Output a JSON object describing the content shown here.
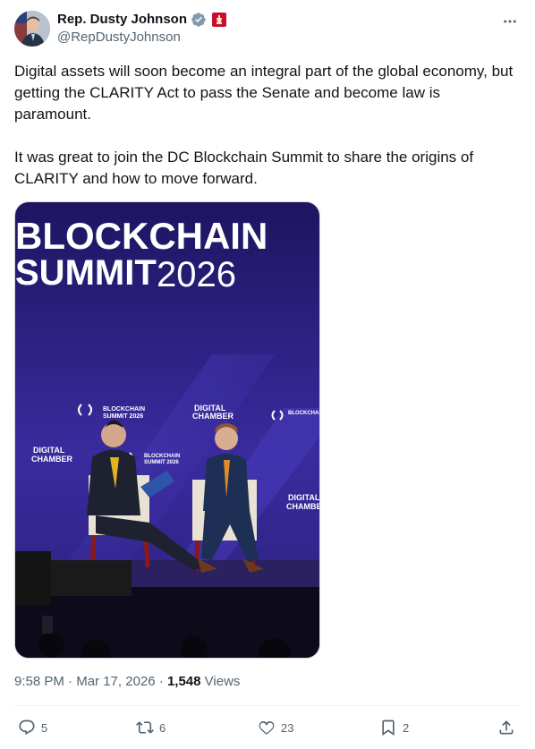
{
  "author": {
    "display_name": "Rep. Dusty Johnson",
    "handle": "@RepDustyJohnson"
  },
  "tweet": {
    "text": "Digital assets will soon become an integral part of the global economy, but getting the CLARITY Act to pass the Senate and become law is paramount.\n\nIt was great to join the DC Blockchain Summit to share the origins of CLARITY and how to move forward."
  },
  "media": {
    "banner_line1": "BLOCKCHAIN",
    "banner_line2": "SUMMIT",
    "banner_year": "2026",
    "backdrop_logo_line1": "BLOCKCHAIN",
    "backdrop_logo_line2": "SUMMIT 2026",
    "backdrop_chamber_line1": "DIGITAL",
    "backdrop_chamber_line2": "CHAMBER"
  },
  "meta": {
    "time": "9:58 PM",
    "separator1": " · ",
    "date": "Mar 17, 2026",
    "separator2": " · ",
    "views_count": "1,548",
    "views_label": " Views"
  },
  "actions": {
    "replies": "5",
    "reposts": "6",
    "likes": "23",
    "bookmarks": "2"
  },
  "colors": {
    "text_primary": "#0f1419",
    "text_secondary": "#536471",
    "verified": "#829aab",
    "affiliation_red": "#c8102e",
    "stage_purple": "#3a2b9e"
  },
  "icons": [
    "verified-badge-icon",
    "affiliation-icon",
    "more-icon",
    "reply-icon",
    "repost-icon",
    "like-icon",
    "bookmark-icon",
    "share-icon"
  ]
}
